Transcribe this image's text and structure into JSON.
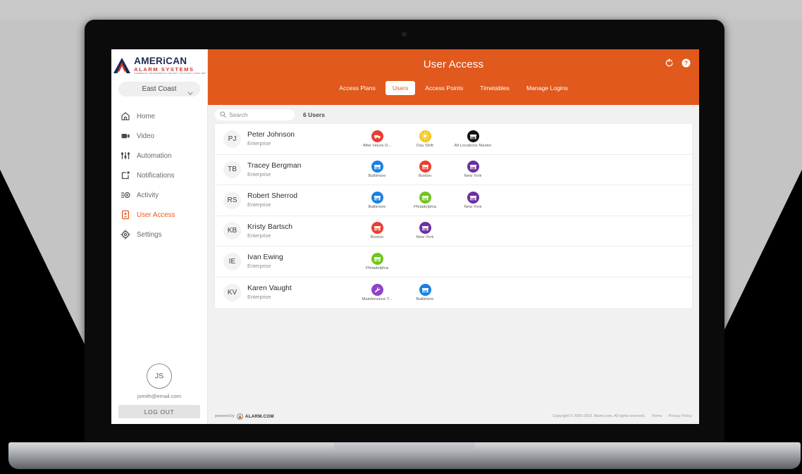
{
  "brand": {
    "logo_american": "AMERiCAN",
    "logo_alarm": "ALARM SYSTEMS",
    "logo_tagline": "COMMERCIAL AND RESIDENTIAL SECURITY SOLUTIONS | SINCE 1982",
    "accent_orange": "#e1591c",
    "navy": "#1c2b52",
    "red": "#d8352a"
  },
  "sidebar": {
    "region_selector": "East Coast",
    "items": [
      {
        "label": "Home",
        "icon": "home-icon",
        "active": false
      },
      {
        "label": "Video",
        "icon": "video-camera-icon",
        "active": false
      },
      {
        "label": "Automation",
        "icon": "sliders-icon",
        "active": false
      },
      {
        "label": "Notifications",
        "icon": "notification-square-icon",
        "active": false
      },
      {
        "label": "Activity",
        "icon": "activity-list-icon",
        "active": false
      },
      {
        "label": "User Access",
        "icon": "user-badge-icon",
        "active": true
      },
      {
        "label": "Settings",
        "icon": "gear-icon",
        "active": false
      }
    ],
    "profile": {
      "initials": "JS",
      "email": "jsmith@email.com",
      "logout_label": "LOG OUT"
    }
  },
  "header": {
    "title": "User Access",
    "refresh_icon": "refresh-icon",
    "help_icon": "help-icon",
    "tabs": [
      {
        "label": "Access Plans",
        "active": false
      },
      {
        "label": "Users",
        "active": true
      },
      {
        "label": "Access Points",
        "active": false
      },
      {
        "label": "Timetables",
        "active": false
      },
      {
        "label": "Manage Logins",
        "active": false
      }
    ]
  },
  "toolbar": {
    "search_placeholder": "Search",
    "search_value": "",
    "search_icon": "search-icon",
    "user_count": "6 Users"
  },
  "users": [
    {
      "initials": "PJ",
      "name": "Peter Johnson",
      "plan": "Enterprise",
      "badges": [
        {
          "label": "After Hours D...",
          "color": "#ef3b2d",
          "glyph": "truck"
        },
        {
          "label": "Day Shift",
          "color": "#f5c518",
          "glyph": "sun"
        },
        {
          "label": "All Locations Master",
          "color": "#111111",
          "glyph": "store"
        }
      ]
    },
    {
      "initials": "TB",
      "name": "Tracey Bergman",
      "plan": "Enterprise",
      "badges": [
        {
          "label": "Baltimore",
          "color": "#1781e3",
          "glyph": "store"
        },
        {
          "label": "Boston",
          "color": "#ef3b2d",
          "glyph": "store"
        },
        {
          "label": "New York",
          "color": "#6b2fa0",
          "glyph": "store"
        }
      ]
    },
    {
      "initials": "RS",
      "name": "Robert Sherrod",
      "plan": "Enterprise",
      "badges": [
        {
          "label": "Baltimore",
          "color": "#1781e3",
          "glyph": "store"
        },
        {
          "label": "Philadelphia",
          "color": "#6ec71a",
          "glyph": "store"
        },
        {
          "label": "New York",
          "color": "#6b2fa0",
          "glyph": "store"
        }
      ]
    },
    {
      "initials": "KB",
      "name": "Kristy Bartsch",
      "plan": "Enterprise",
      "badges": [
        {
          "label": "Boston",
          "color": "#ef3b2d",
          "glyph": "store"
        },
        {
          "label": "New York",
          "color": "#6b2fa0",
          "glyph": "store"
        }
      ]
    },
    {
      "initials": "IE",
      "name": "Ivan Ewing",
      "plan": "Enterprise",
      "badges": [
        {
          "label": "Philadelphia",
          "color": "#6ec71a",
          "glyph": "store"
        }
      ]
    },
    {
      "initials": "KV",
      "name": "Karen Vaught",
      "plan": "Enterprise",
      "badges": [
        {
          "label": "Maintenance T...",
          "color": "#8e44c8",
          "glyph": "wrench"
        },
        {
          "label": "Baltimore",
          "color": "#1781e3",
          "glyph": "store"
        }
      ]
    }
  ],
  "footer": {
    "powered_by": "powered by",
    "powered_brand": "ALARM.COM",
    "copyright": "Copyright © 2000-2019. Alarm.com. All rights reserved.",
    "terms": "Terms",
    "privacy": "Privacy Policy"
  }
}
